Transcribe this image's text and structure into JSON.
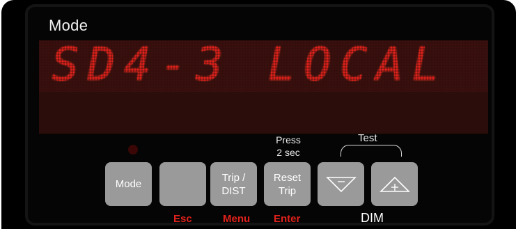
{
  "panel": {
    "heading": "Mode",
    "display_text": "SD4-3 LOCAL"
  },
  "keys": {
    "mode": {
      "label": "Mode"
    },
    "esc": {
      "label": "",
      "sublabel": "Esc"
    },
    "trip": {
      "line1": "Trip /",
      "line2": "DIST",
      "sublabel": "Menu"
    },
    "reset": {
      "line1": "Reset",
      "line2": "Trip",
      "sublabel": "Enter",
      "note_line1": "Press",
      "note_line2": "2 sec"
    },
    "down": {
      "icon": "triangle-down-minus-icon"
    },
    "up": {
      "icon": "triangle-up-plus-icon"
    }
  },
  "test_group": {
    "label": "Test",
    "sublabel": "DIM"
  },
  "colors": {
    "display_red": "#e0211b",
    "key_gray": "#9a9a9a",
    "panel_black": "#000000"
  }
}
